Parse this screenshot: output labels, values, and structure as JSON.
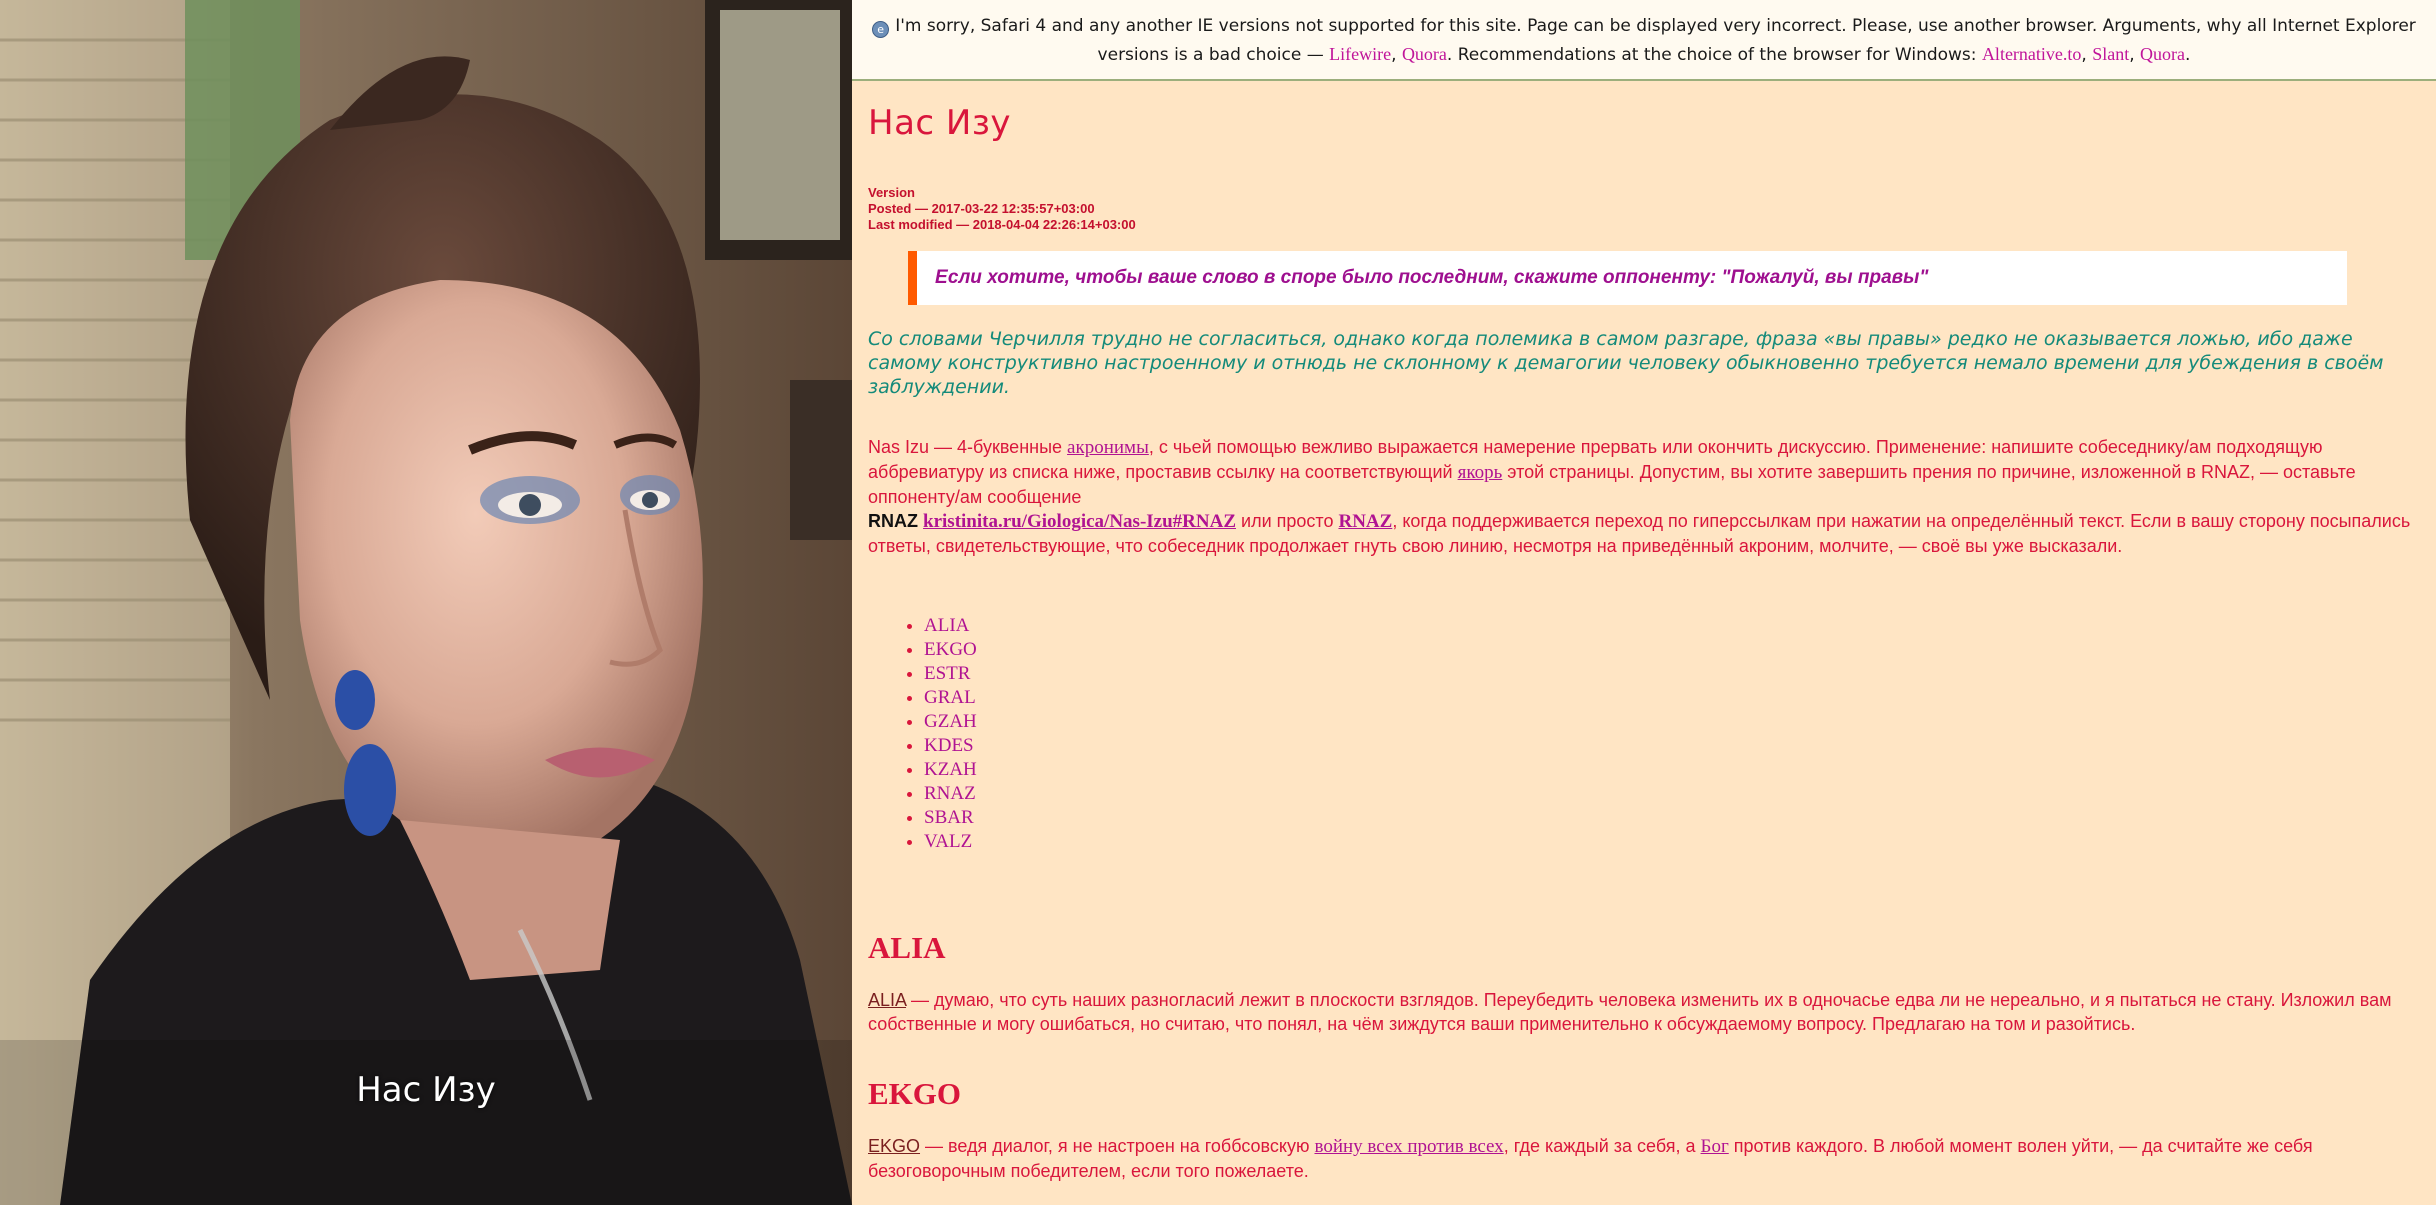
{
  "photo": {
    "caption": "Нас Изу"
  },
  "notice": {
    "text_before": "I'm sorry, Safari 4 and any another IE versions not supported for this site. Page can be displayed very incorrect. Please, use another browser. Arguments, why all Internet Explorer versions is a bad choice —",
    "link_lifewire": "Lifewire",
    "sep1": ",",
    "link_quora1": "Quora",
    "text_middle": ". Recommendations at the choice of the browser for Windows:",
    "link_alternative": "Alternative.to",
    "sep2": ",",
    "link_slant": "Slant",
    "sep3": ",",
    "link_quora2": "Quora",
    "end": "."
  },
  "page": {
    "title": "Нас Изу",
    "version_label": "Version",
    "posted": "Posted — 2017-03-22 12:35:57+03:00",
    "modified": "Last modified — 2018-04-04 22:26:14+03:00",
    "epigraph": "Если хотите, чтобы ваше слово в споре было последним, скажите оппоненту: \"Пожалуй, вы правы\"",
    "intro_italic": "Со словами Черчилля трудно не согласиться, однако когда полемика в самом разгаре, фраза «вы правы» редко не оказывается ложью, ибо даже самому конструктивно настроенному и отнюдь не склонному к демагогии человеку обыкновенно требуется немало времени для убеждения в своём заблуждении.",
    "intro": {
      "part1": "Nas Izu — 4-буквенные",
      "link_acronyms": "акронимы",
      "part2": ", с чьей помощью вежливо выражается намерение прервать или окончить дискуссию. Применение: напишите собеседнику/ам подходящую аббревиатуру из списка ниже, проставив ссылку на соответствующий",
      "link_anchor": "якорь",
      "part3": "этой страницы. Допустим, вы хотите завершить прения по причине, изложенной в RNAZ, — оставьте оппоненту/ам сообщение",
      "rnaz_label": "RNAZ",
      "rnaz_url": "kristinita.ru/Giologica/Nas-Izu#RNAZ",
      "part4": "или просто",
      "rnaz_short": "RNAZ",
      "part5": ", когда поддерживается переход по гиперссылкам при нажатии на определённый текст. Если в вашу сторону посыпались ответы, свидетельствующие, что собеседник продолжает гнуть свою линию, несмотря на приведённый акроним, молчите, — своё вы уже высказали."
    },
    "acronyms": [
      "ALIA",
      "EKGO",
      "ESTR",
      "GRAL",
      "GZAH",
      "KDES",
      "KZAH",
      "RNAZ",
      "SBAR",
      "VALZ"
    ],
    "sections": {
      "alia": {
        "title": "ALIA",
        "term": "ALIA",
        "text": " — думаю, что суть наших разногласий лежит в плоскости взглядов. Переубедить человека изменить их в одночасье едва ли не нереально, и я пытаться не стану. Изложил вам собственные и могу ошибаться, но считаю, что понял, на чём зиждутся ваши применительно к обсуждаемому вопросу. Предлагаю на том и разойтись."
      },
      "ekgo": {
        "title": "EKGO",
        "term": "EKGO",
        "text_a": " — ведя диалог, я не настроен на гоббсовскую",
        "link_war": "войну всех против всех",
        "text_b": ", где каждый за себя, а",
        "link_god": "Бог",
        "text_c": "против каждого. В любой момент волен уйти, — да считайте же себя безоговорочным победителем, если того пожелаете."
      }
    }
  },
  "colors": {
    "background": "#ffe5c4",
    "accent": "#d9163c",
    "link": "#b01392",
    "epigraph_border": "#ff5a00",
    "italic_teal": "#148a7a"
  }
}
